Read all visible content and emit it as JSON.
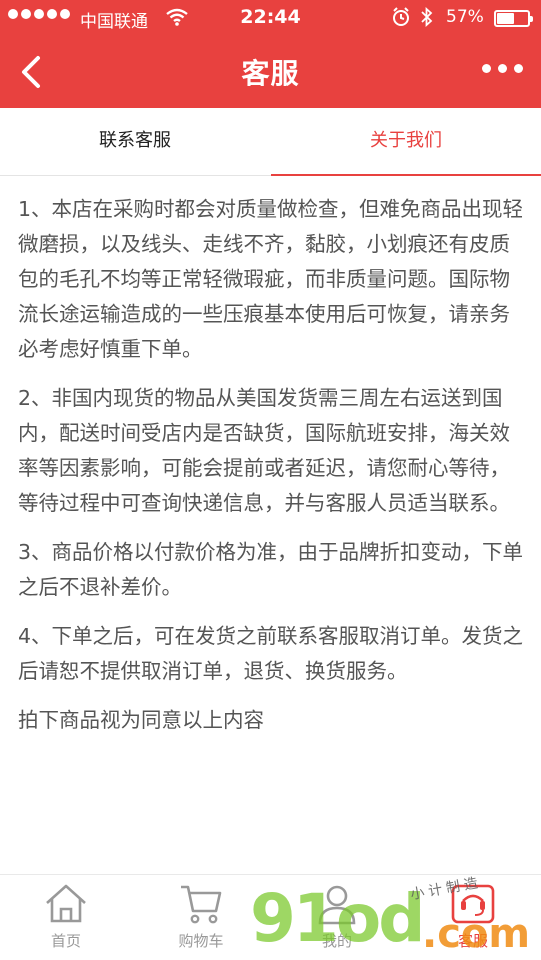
{
  "status_bar": {
    "carrier": "中国联通",
    "time": "22:44",
    "battery_percent": "57%",
    "battery_level": 0.57
  },
  "nav": {
    "title": "客服",
    "back_icon": "chevron-left-icon",
    "more_icon": "more-dots-icon"
  },
  "tabs": [
    {
      "label": "联系客服",
      "active": false
    },
    {
      "label": "关于我们",
      "active": true
    }
  ],
  "content": {
    "paragraphs": [
      "1、本店在采购时都会对质量做检查，但难免商品出现轻微磨损，以及线头、走线不齐，黏胶，小划痕还有皮质包的毛孔不均等正常轻微瑕疵，而非质量问题。国际物流长途运输造成的一些压痕基本使用后可恢复，请亲务必考虑好慎重下单。",
      "2、非国内现货的物品从美国发货需三周左右运送到国内，配送时间受店内是否缺货，国际航班安排，海关效率等因素影响，可能会提前或者延迟，请您耐心等待，等待过程中可查询快递信息，并与客服人员适当联系。",
      "3、商品价格以付款价格为准，由于品牌折扣变动，下单之后不退补差价。",
      "4、下单之后，可在发货之前联系客服取消订单。发货之后请恕不提供取消订单，退货、换货服务。",
      "拍下商品视为同意以上内容"
    ]
  },
  "tabbar": [
    {
      "label": "首页",
      "icon": "home-icon",
      "active": false
    },
    {
      "label": "购物车",
      "icon": "cart-icon",
      "active": false
    },
    {
      "label": "我的",
      "icon": "user-icon",
      "active": false
    },
    {
      "label": "客服",
      "icon": "customer-service-icon",
      "active": true
    }
  ],
  "watermark": {
    "main": "91od",
    "suffix": ".com",
    "small": "小计制造"
  },
  "colors": {
    "brand": "#e8413f",
    "text": "#555555",
    "inactive": "#999999"
  }
}
